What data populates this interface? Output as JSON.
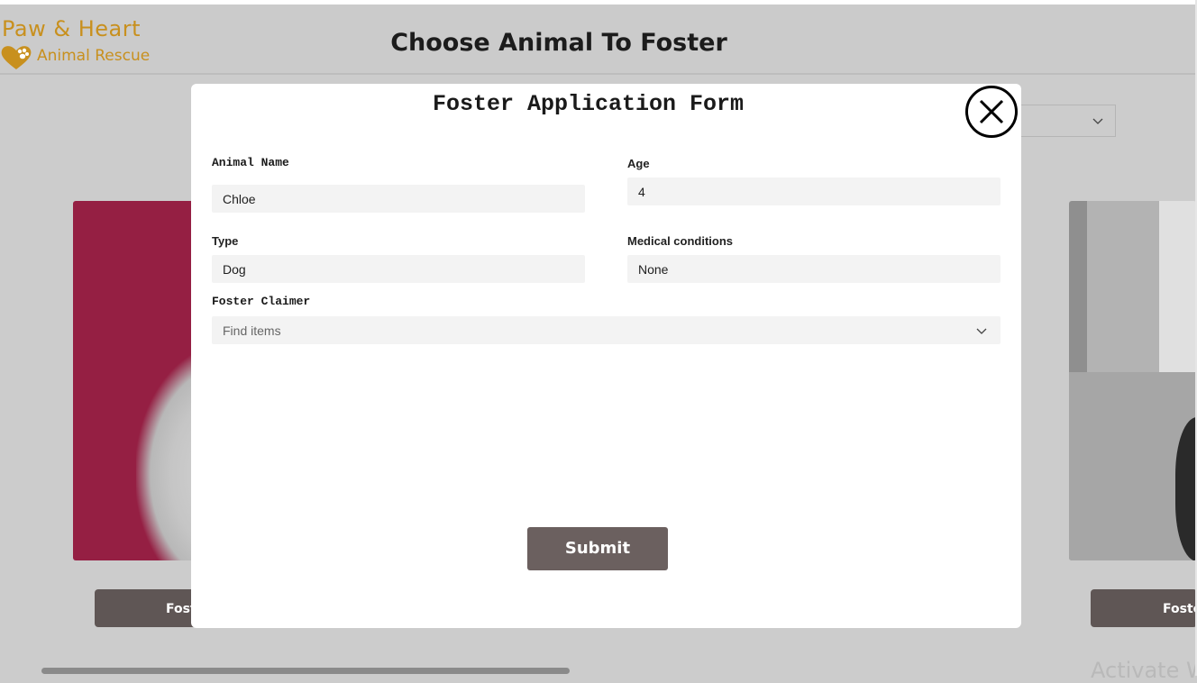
{
  "header": {
    "logo_line1": "Paw & Heart",
    "logo_line2": "Animal Rescue",
    "title": "Choose Animal To Foster"
  },
  "background": {
    "foster_button_left": "Foster",
    "foster_button_right": "Foster",
    "watermark": "Activate W"
  },
  "modal": {
    "title": "Foster Application Form",
    "fields": {
      "animal_name": {
        "label": "Animal Name",
        "value": "Chloe"
      },
      "age": {
        "label": "Age",
        "value": "4"
      },
      "type": {
        "label": "Type",
        "value": "Dog"
      },
      "medical": {
        "label": "Medical conditions",
        "value": "None"
      },
      "foster_claimer": {
        "label": "Foster Claimer",
        "placeholder": "Find items"
      }
    },
    "submit_label": "Submit"
  },
  "colors": {
    "brand_gold": "#c8901e",
    "button_dark": "#5f5655",
    "submit": "#6b605f",
    "overlay": "#cccccc"
  }
}
